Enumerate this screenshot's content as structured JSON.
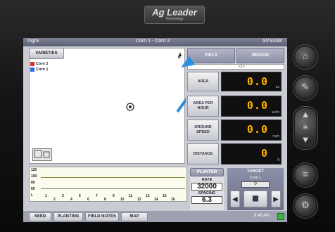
{
  "device": {
    "brand": "Ag Leader",
    "brand_sub": "Technology"
  },
  "topbar": {
    "left": "Ingra",
    "title": "Corn 1 - Corn 2",
    "right": "SVS33M"
  },
  "header_buttons": {
    "varieties": "VARIETIES",
    "field": "FIELD",
    "region": "REGION",
    "field_sub": "<1>"
  },
  "legend": [
    {
      "label": "Corn 2",
      "color": "#d83030"
    },
    {
      "label": "Corn 1",
      "color": "#2a6fd6"
    }
  ],
  "map": {
    "north_label": "N",
    "annotation_color": "#2a8fe0"
  },
  "metrics": [
    {
      "label": "AREA",
      "value": "0.0",
      "unit": "ac"
    },
    {
      "label": "AREA PER HOUR",
      "value": "0.0",
      "unit": "ac/hr"
    },
    {
      "label": "GROUND SPEED",
      "value": "0.0",
      "unit": "mph"
    },
    {
      "label": "DISTANCE",
      "value": "0",
      "unit": "ft"
    }
  ],
  "graph": {
    "y_labels": [
      "120",
      "100",
      "80",
      "60",
      "L"
    ],
    "x_labels": [
      "1",
      "2",
      "3",
      "4",
      "5",
      "6",
      "7",
      "8",
      "9",
      "10",
      "11",
      "12",
      "13",
      "14",
      "15",
      "16"
    ]
  },
  "planter": {
    "planter_label": "PLANTER",
    "rate_label": "RATE",
    "rate_value": "32000",
    "spacing_label": "SPACING",
    "spacing_value": "6.3"
  },
  "target": {
    "title": "TARGET",
    "name": "Corn 1",
    "value": "0"
  },
  "bottom_tabs": [
    "SEED",
    "PLANTING",
    "FIELD NOTES",
    "MAP"
  ],
  "clock": "9:48 AM",
  "status_color": "#3cb043"
}
